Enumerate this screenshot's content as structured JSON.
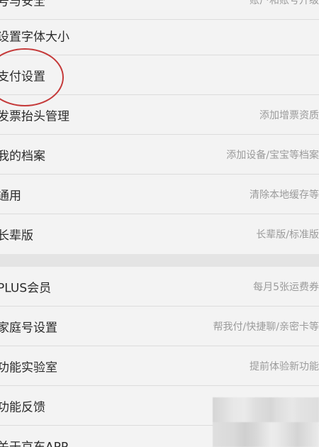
{
  "rows_group1": [
    {
      "label": "号与安全",
      "value": "账户和账号升级"
    },
    {
      "label": "设置字体大小",
      "value": ""
    },
    {
      "label": "支付设置",
      "value": ""
    },
    {
      "label": "发票抬头管理",
      "value": "添加增票资质"
    },
    {
      "label": "我的档案",
      "value": "添加设备/宝宝等档案"
    },
    {
      "label": "通用",
      "value": "清除本地缓存等"
    },
    {
      "label": "长辈版",
      "value": "长辈版/标准版"
    }
  ],
  "rows_group2": [
    {
      "label": "PLUS会员",
      "value": "每月5张运费券"
    },
    {
      "label": "家庭号设置",
      "value": "帮我付/快捷聊/亲密卡等"
    },
    {
      "label": "功能实验室",
      "value": "提前体验新功能"
    },
    {
      "label": "功能反馈",
      "value": ""
    },
    {
      "label": "关于京东APP",
      "value": ""
    }
  ],
  "colors": {
    "background": "#f3f3f3",
    "divider": "#dcdcdc",
    "label": "#2b2b2b",
    "value": "#9b9b9b",
    "annotation": "#c53a3a"
  }
}
